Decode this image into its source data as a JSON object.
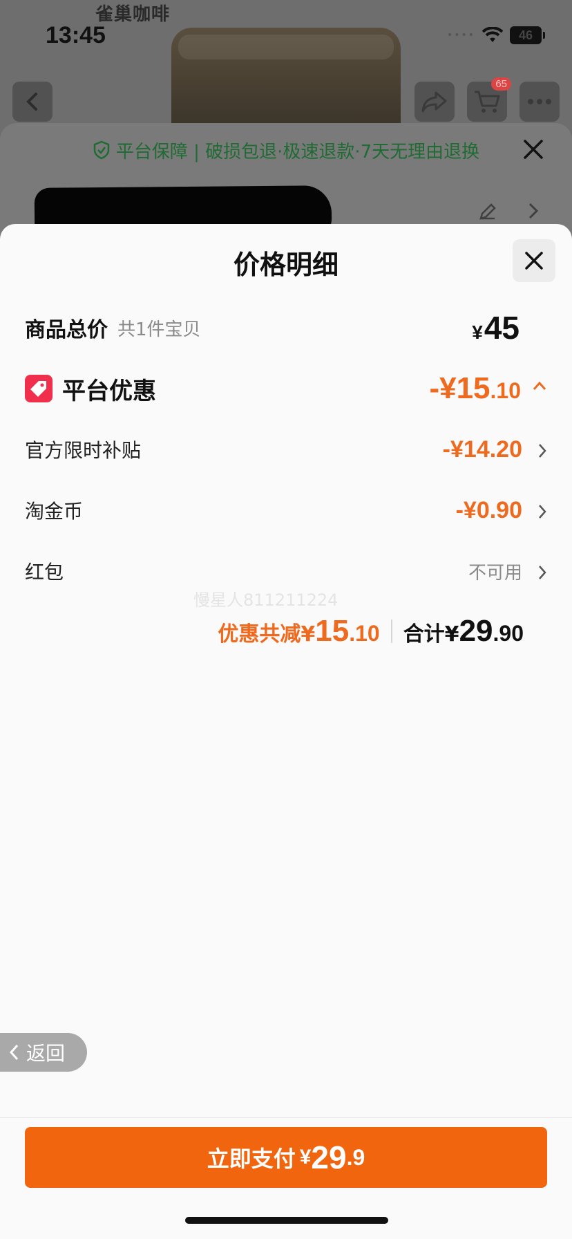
{
  "status_bar": {
    "time": "13:45",
    "battery": "46"
  },
  "background": {
    "brand": "雀巢咖啡",
    "cart_badge": "65",
    "guarantee": {
      "text": "平台保障 | 破损包退·极速退款·7天无理由退换"
    }
  },
  "sheet": {
    "title": "价格明细",
    "goods_total": {
      "label": "商品总价",
      "sub": "共1件宝贝",
      "yen": "¥",
      "amount": "45"
    },
    "platform_discount": {
      "label": "平台优惠",
      "prefix": "-¥",
      "int": "15",
      "dec": ".10"
    },
    "items": [
      {
        "label": "官方限时补贴",
        "value": "-¥14.20"
      },
      {
        "label": "淘金币",
        "value": "-¥0.90"
      },
      {
        "label": "红包",
        "value": "不可用"
      }
    ],
    "watermark": "慢星人811211224",
    "summary": {
      "discount_label": "优惠共减¥",
      "discount_int": "15",
      "discount_dec": ".10",
      "total_label": "合计¥",
      "total_int": "29",
      "total_dec": ".90"
    },
    "back_label": "返回",
    "pay": {
      "label": "立即支付",
      "yen": "¥",
      "int": "29",
      "dec": ".9"
    }
  },
  "colors": {
    "accent": "#f1650f",
    "discount": "#ee6a1f",
    "tag": "#ef2f4b",
    "guarantee": "#1f6b33"
  },
  "icons": [
    "back-icon",
    "share-icon",
    "cart-icon",
    "more-icon",
    "shield-icon",
    "close-icon",
    "edit-icon",
    "chevron-right-icon",
    "tag-icon",
    "chevron-up-icon",
    "chevron-left-icon",
    "wifi-icon"
  ]
}
